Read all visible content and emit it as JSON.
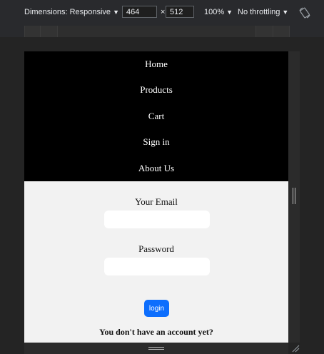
{
  "devtools": {
    "dimensions_label": "Dimensions: Responsive",
    "width_value": "464",
    "times": "×",
    "height_value": "512",
    "zoom_label": "100%",
    "throttle_label": "No throttling",
    "caret": "▼"
  },
  "nav": {
    "items": [
      {
        "label": "Home"
      },
      {
        "label": "Products"
      },
      {
        "label": "Cart"
      },
      {
        "label": "Sign in"
      },
      {
        "label": "About Us"
      }
    ]
  },
  "form": {
    "email_label": "Your Email",
    "email_value": "",
    "password_label": "Password",
    "password_value": "",
    "login_label": "login",
    "no_account_text": "You don't have an account yet?"
  },
  "colors": {
    "nav_bg": "#000000",
    "page_bg": "#f2f2f2",
    "button_blue": "#0d6efd"
  }
}
